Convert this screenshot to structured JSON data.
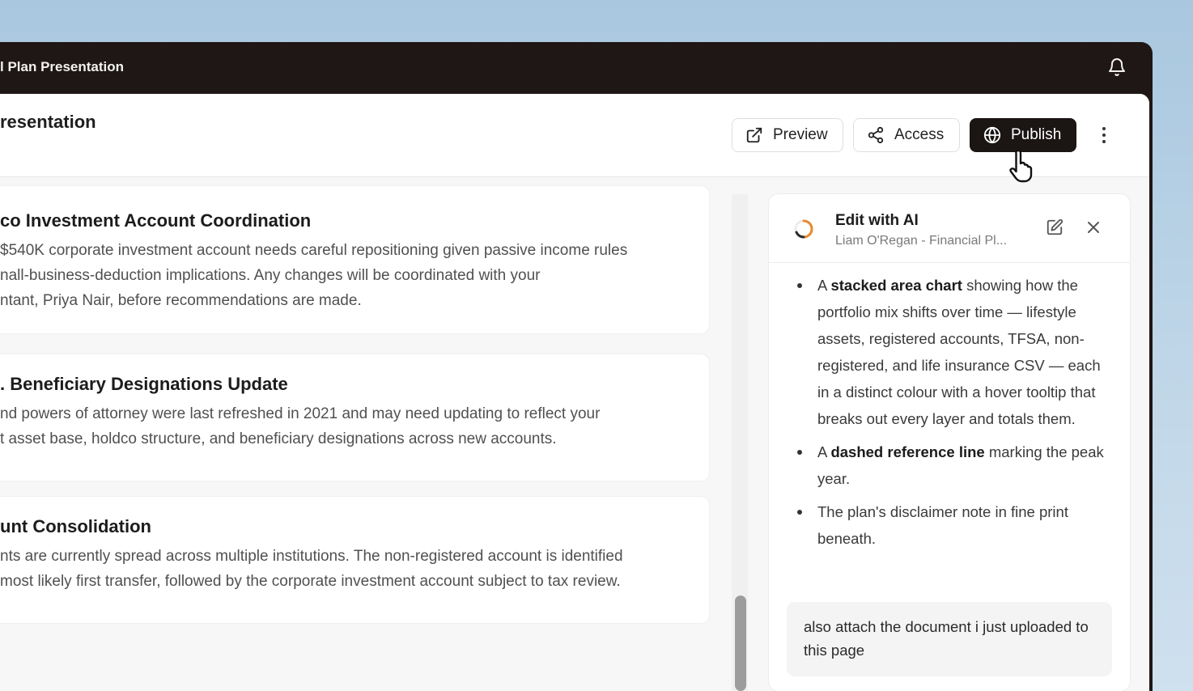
{
  "window": {
    "title": "l Plan Presentation"
  },
  "header": {
    "page_title": "resentation",
    "preview_label": "Preview",
    "access_label": "Access",
    "publish_label": "Publish"
  },
  "cards": [
    {
      "title": "co Investment Account Coordination",
      "lines": [
        "$540K corporate investment account needs careful repositioning given passive income rules",
        "nall-business-deduction implications. Any changes will be coordinated with your",
        "ntant, Priya Nair, before recommendations are made."
      ]
    },
    {
      "title": ". Beneficiary Designations Update",
      "lines": [
        "nd powers of attorney were last refreshed in 2021 and may need updating to reflect your",
        "t asset base, holdco structure, and beneficiary designations across new accounts."
      ]
    },
    {
      "title": "unt Consolidation",
      "lines": [
        "nts are currently spread across multiple institutions. The non-registered account is identified",
        " most likely first transfer, followed by the corporate investment account subject to tax review."
      ]
    }
  ],
  "ai_panel": {
    "title": "Edit with AI",
    "subtitle": "Liam O'Regan - Financial Pl...",
    "bullets": [
      {
        "pre": "A ",
        "bold": "stacked area chart",
        "post": " showing how the portfolio mix shifts over time — lifestyle assets, registered accounts, TFSA, non-registered, and life insurance CSV — each in a distinct colour with a hover tooltip that breaks out every layer and totals them."
      },
      {
        "pre": "A ",
        "bold": "dashed reference line",
        "post": " marking the peak year."
      },
      {
        "pre": "The plan's disclaimer note in fine print beneath.",
        "bold": "",
        "post": ""
      }
    ],
    "input_text": "also attach the document i just uploaded to this page"
  },
  "icons": {
    "bell": "bell-icon",
    "preview": "external-link-icon",
    "access": "share-icon",
    "publish": "globe-icon",
    "more": "more-vertical-icon",
    "ai_logo": "ai-spinner-logo",
    "edit": "edit-icon",
    "close": "close-icon",
    "cursor": "hand-pointer-cursor"
  },
  "colors": {
    "titlebar": "#1e1716",
    "publish_bg": "#1b1514",
    "accent_orange": "#e8892e"
  }
}
